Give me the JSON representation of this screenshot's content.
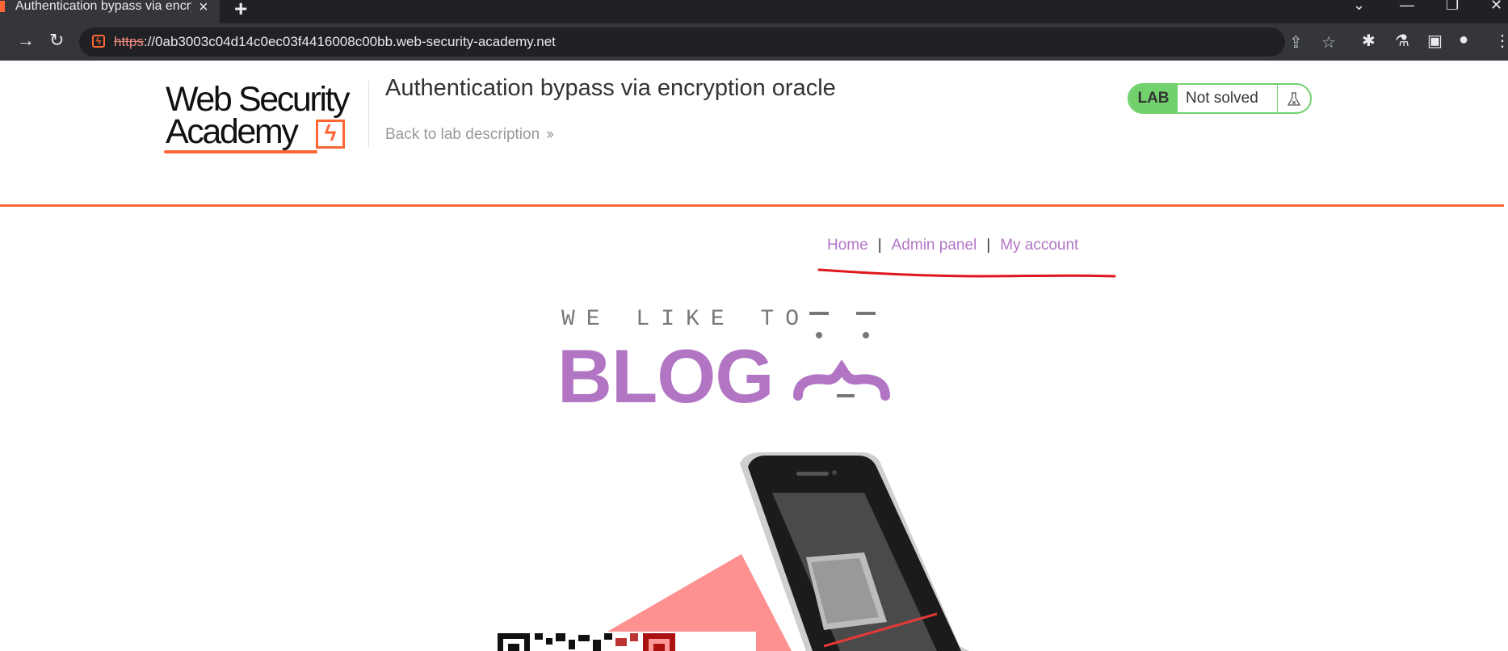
{
  "browser": {
    "tab_title": "Authentication bypass via encryption oracle",
    "new_tab_glyph": "+",
    "url_scheme": "https",
    "url_sep": "://",
    "url_host": "0ab3003c04d14c0ec03f4416008c00bb.web-security-academy.net",
    "icons": [
      "forward-icon",
      "reload-icon",
      "site-info-icon",
      "share-icon",
      "bookmark-star-icon",
      "extensions-icon",
      "lab-extension-icon",
      "side-panel-icon",
      "profile-icon",
      "menu-icon"
    ]
  },
  "header": {
    "logo_line1": "Web Security",
    "logo_line2": "Academy",
    "lab_title": "Authentication bypass via encryption oracle",
    "back_link": "Back to lab description",
    "lab_badge": "LAB",
    "lab_status": "Not solved"
  },
  "nav": {
    "items": [
      {
        "label": "Home"
      },
      {
        "label": "Admin panel"
      },
      {
        "label": "My account"
      }
    ],
    "separator": "|"
  },
  "blog": {
    "tagline": "WE LIKE TO",
    "word": "BLOG"
  },
  "colors": {
    "accent_orange": "#ff6633",
    "nav_purple": "#b175c4",
    "lab_green": "#70d16d",
    "annotation_red": "#e0161c"
  }
}
